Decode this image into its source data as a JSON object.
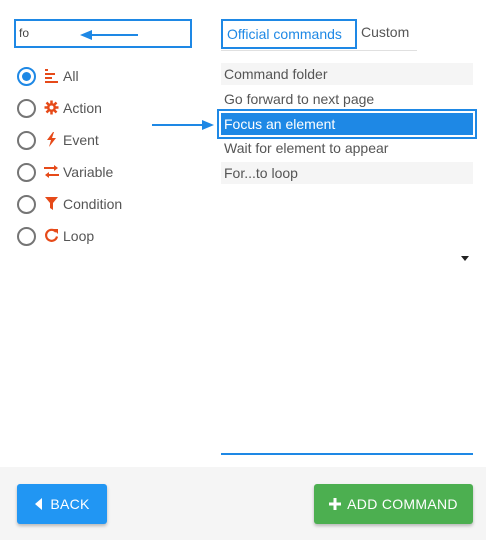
{
  "search": {
    "value": "fo",
    "placeholder": ""
  },
  "filters": [
    {
      "label": "All",
      "icon": "list-icon",
      "checked": true
    },
    {
      "label": "Action",
      "icon": "gear-icon",
      "checked": false
    },
    {
      "label": "Event",
      "icon": "lightning-icon",
      "checked": false
    },
    {
      "label": "Variable",
      "icon": "swap-arrows-icon",
      "checked": false
    },
    {
      "label": "Condition",
      "icon": "filter-icon",
      "checked": false
    },
    {
      "label": "Loop",
      "icon": "refresh-icon",
      "checked": false
    }
  ],
  "tabs": {
    "official": "Official commands",
    "custom": "Custom"
  },
  "commands": [
    {
      "label": "Command folder",
      "state": "shaded"
    },
    {
      "label": "Go forward to next page",
      "state": "plain"
    },
    {
      "label": "Focus an element",
      "state": "selected"
    },
    {
      "label": "Wait for element to appear",
      "state": "plain"
    },
    {
      "label": "For...to loop",
      "state": "shaded"
    }
  ],
  "buttons": {
    "back": "BACK",
    "add": "ADD COMMAND"
  },
  "colors": {
    "accent": "#1e88e5",
    "icon": "#e64a19",
    "add_button": "#4caf50",
    "back_button": "#2196f3"
  }
}
